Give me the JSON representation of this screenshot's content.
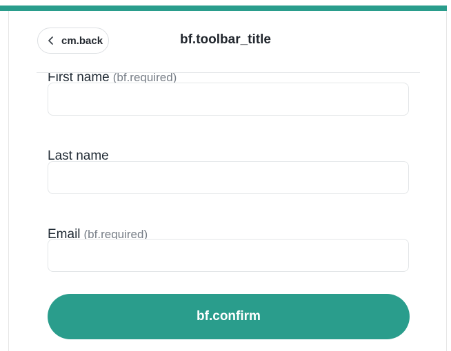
{
  "header": {
    "back_label": "cm.back",
    "title": "bf.toolbar_title"
  },
  "form": {
    "fields": [
      {
        "label": "First name",
        "required_hint": "(bf.required)",
        "value": ""
      },
      {
        "label": "Last name",
        "required_hint": "",
        "value": ""
      },
      {
        "label": "Email",
        "required_hint": "(bf.required)",
        "value": ""
      }
    ]
  },
  "confirm_label": "bf.confirm",
  "colors": {
    "accent": "#2a9d8c"
  },
  "icons": {
    "back": "chevron-left-icon"
  }
}
